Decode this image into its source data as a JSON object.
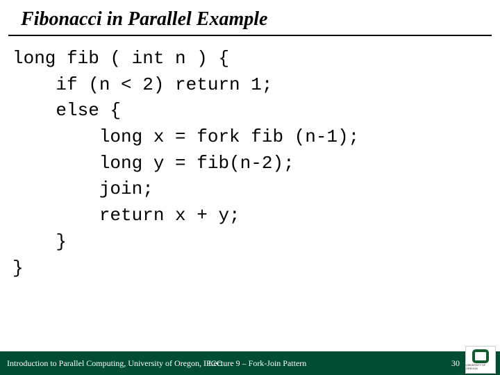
{
  "title": "Fibonacci in Parallel Example",
  "code": "long fib ( int n ) {\n    if (n < 2) return 1;\n    else {\n        long x = fork fib (n-1);\n        long y = fib(n-2);\n        join;\n        return x + y;\n    }\n}",
  "footer": {
    "left": "Introduction to Parallel Computing, University of Oregon, IPCC",
    "center": "Lecture 9 – Fork-Join Pattern",
    "page": "30",
    "logo_text": "UNIVERSITY OF OREGON"
  }
}
